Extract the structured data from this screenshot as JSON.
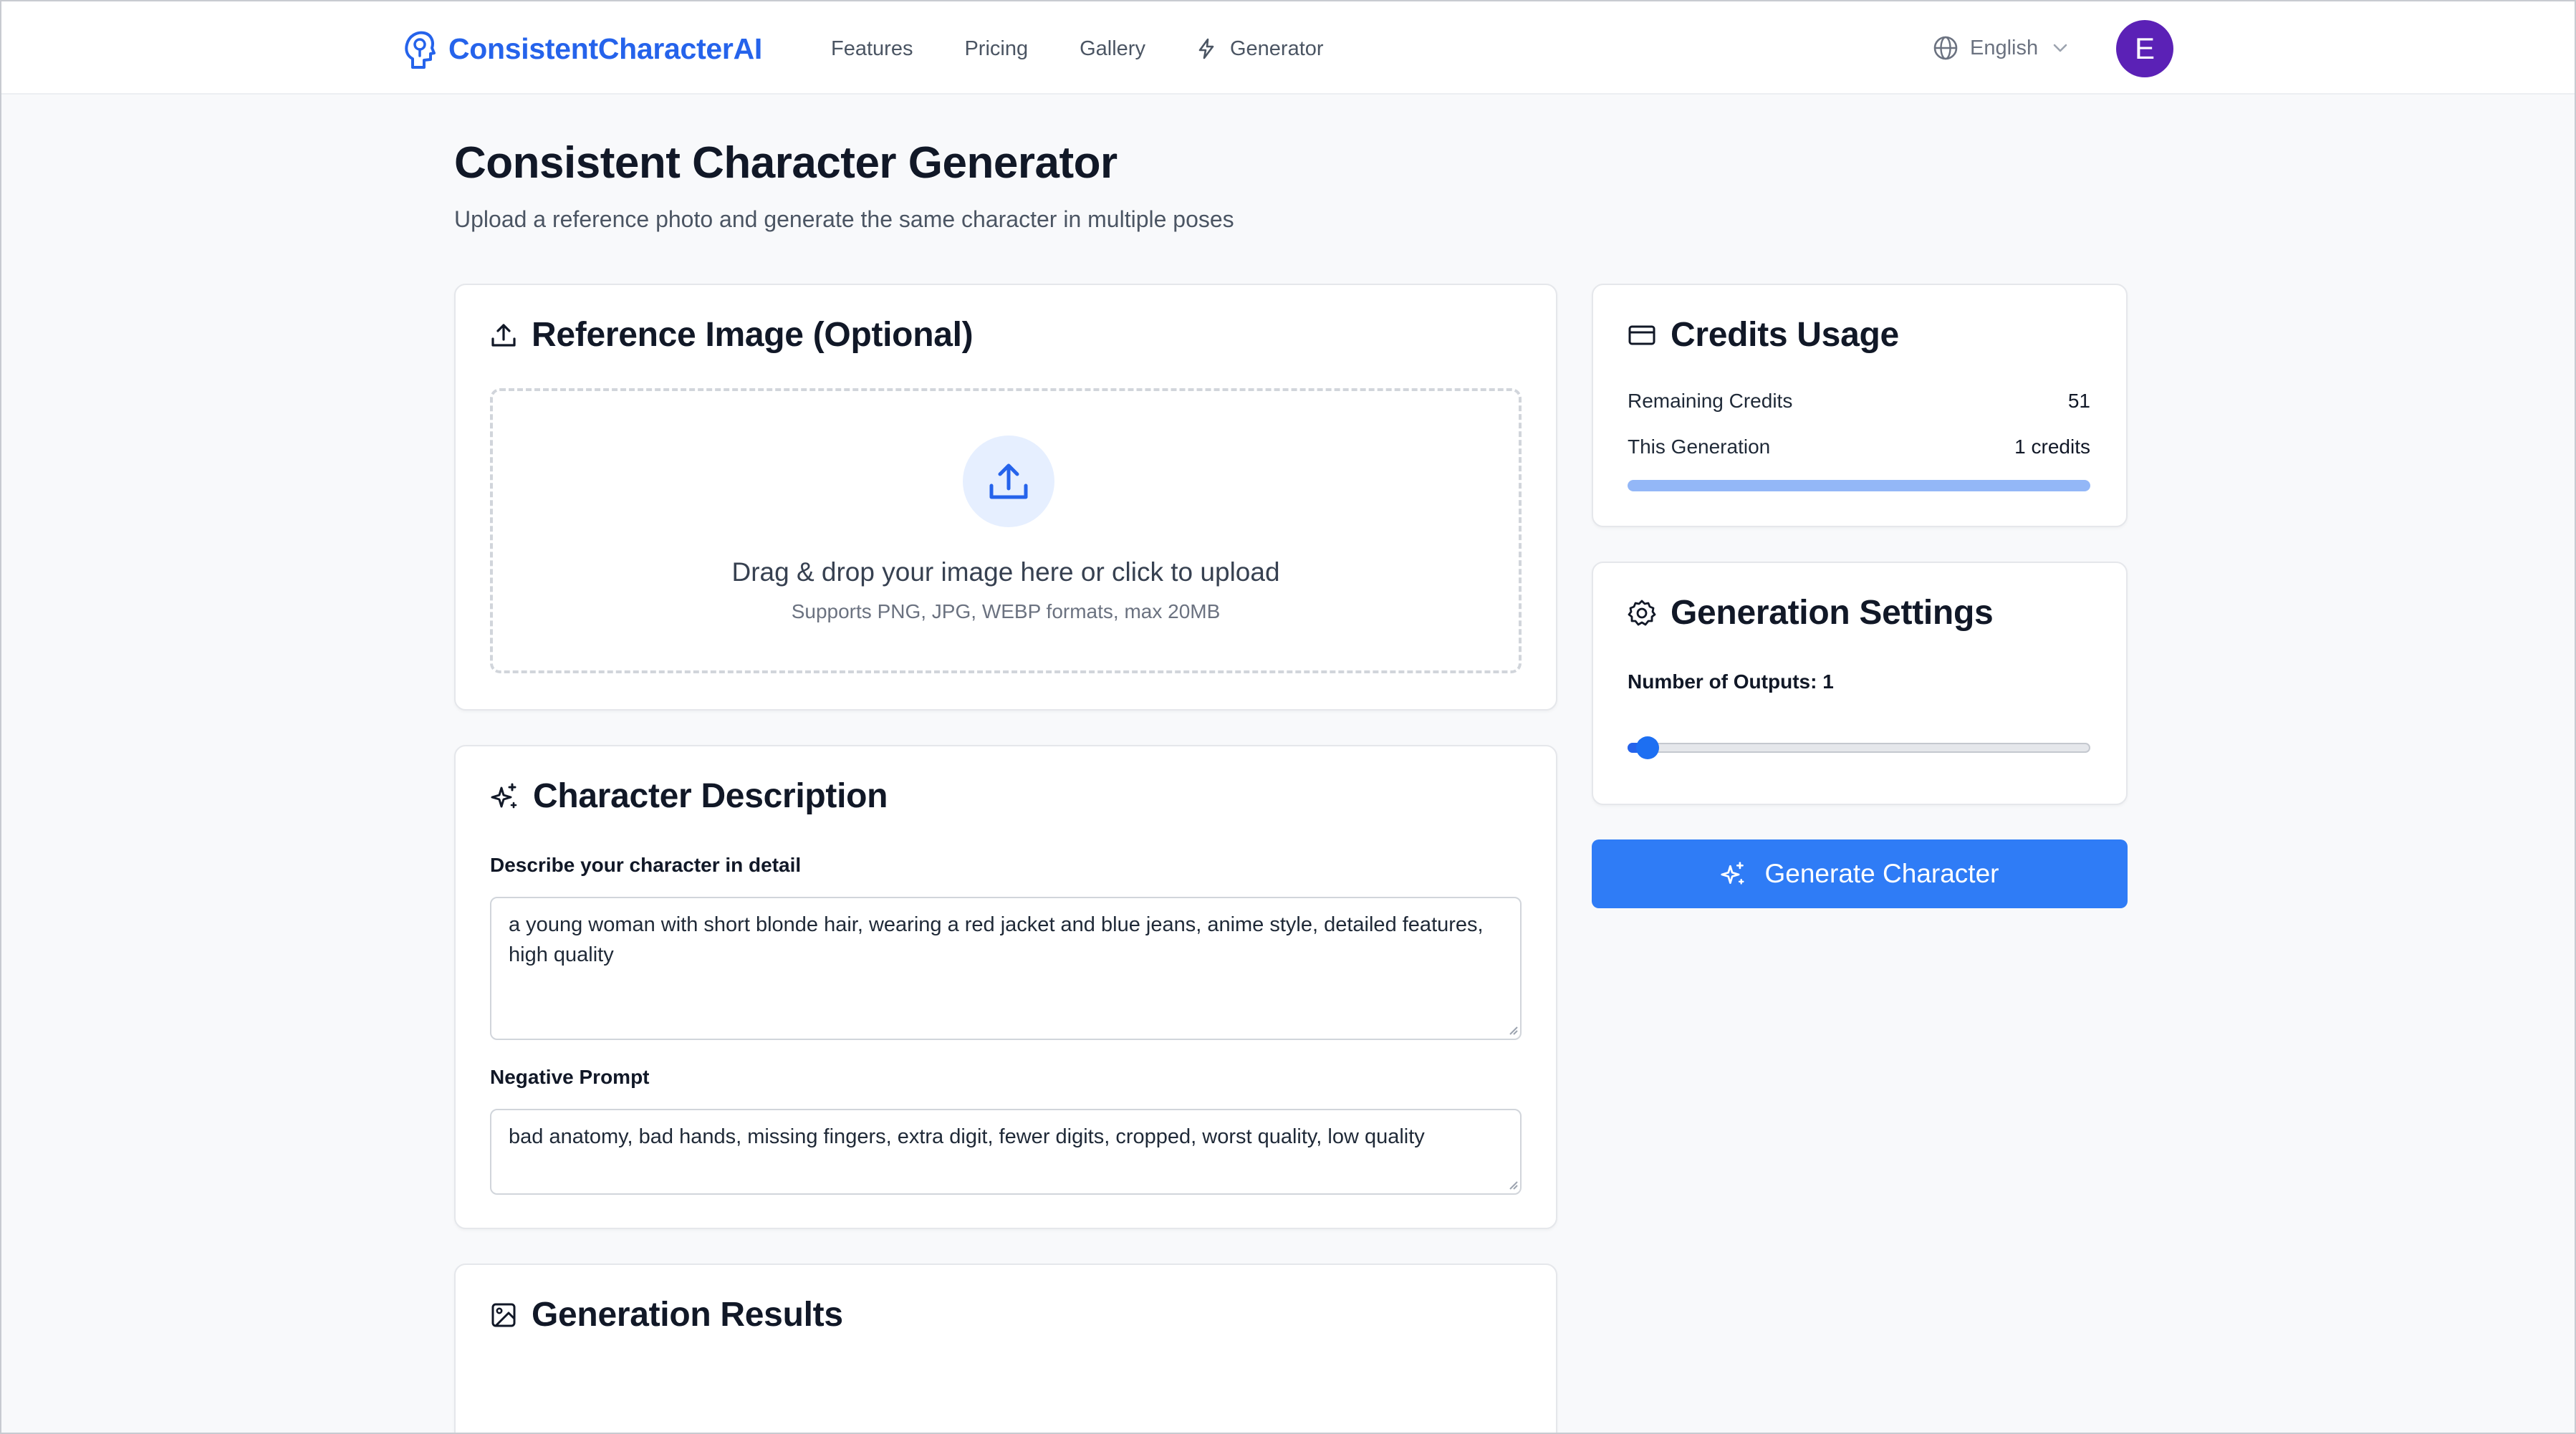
{
  "header": {
    "brand_name": "ConsistentCharacterAI",
    "nav": [
      {
        "label": "Features",
        "icon": null
      },
      {
        "label": "Pricing",
        "icon": null
      },
      {
        "label": "Gallery",
        "icon": null
      },
      {
        "label": "Generator",
        "icon": "lightning-icon"
      }
    ],
    "language": "English",
    "avatar_initial": "E"
  },
  "page": {
    "title": "Consistent Character Generator",
    "subtitle": "Upload a reference photo and generate the same character in multiple poses"
  },
  "reference_card": {
    "title": "Reference Image (Optional)",
    "drop_text": "Drag & drop your image here or click to upload",
    "drop_hint": "Supports PNG, JPG, WEBP formats, max 20MB"
  },
  "description_card": {
    "title": "Character Description",
    "prompt_label": "Describe your character in detail",
    "prompt_value": "a young woman with short blonde hair, wearing a red jacket and blue jeans, anime style, detailed features, high quality",
    "negative_label": "Negative Prompt",
    "negative_value": "bad anatomy, bad hands, missing fingers, extra digit, fewer digits, cropped, worst quality, low quality"
  },
  "results_card": {
    "title": "Generation Results"
  },
  "credits_card": {
    "title": "Credits Usage",
    "remaining_label": "Remaining Credits",
    "remaining_value": "51",
    "generation_label": "This Generation",
    "generation_value": "1 credits",
    "usage_fraction": 1.0
  },
  "settings_card": {
    "title": "Generation Settings",
    "outputs_label": "Number of Outputs: 1",
    "outputs_min": 1,
    "outputs_max": 4,
    "outputs_value": 1
  },
  "generate_button": {
    "label": "Generate Character"
  },
  "colors": {
    "accent": "#2563eb",
    "button": "#2f7cf6",
    "avatar": "#5b21b6",
    "background": "#f8f9fb"
  }
}
